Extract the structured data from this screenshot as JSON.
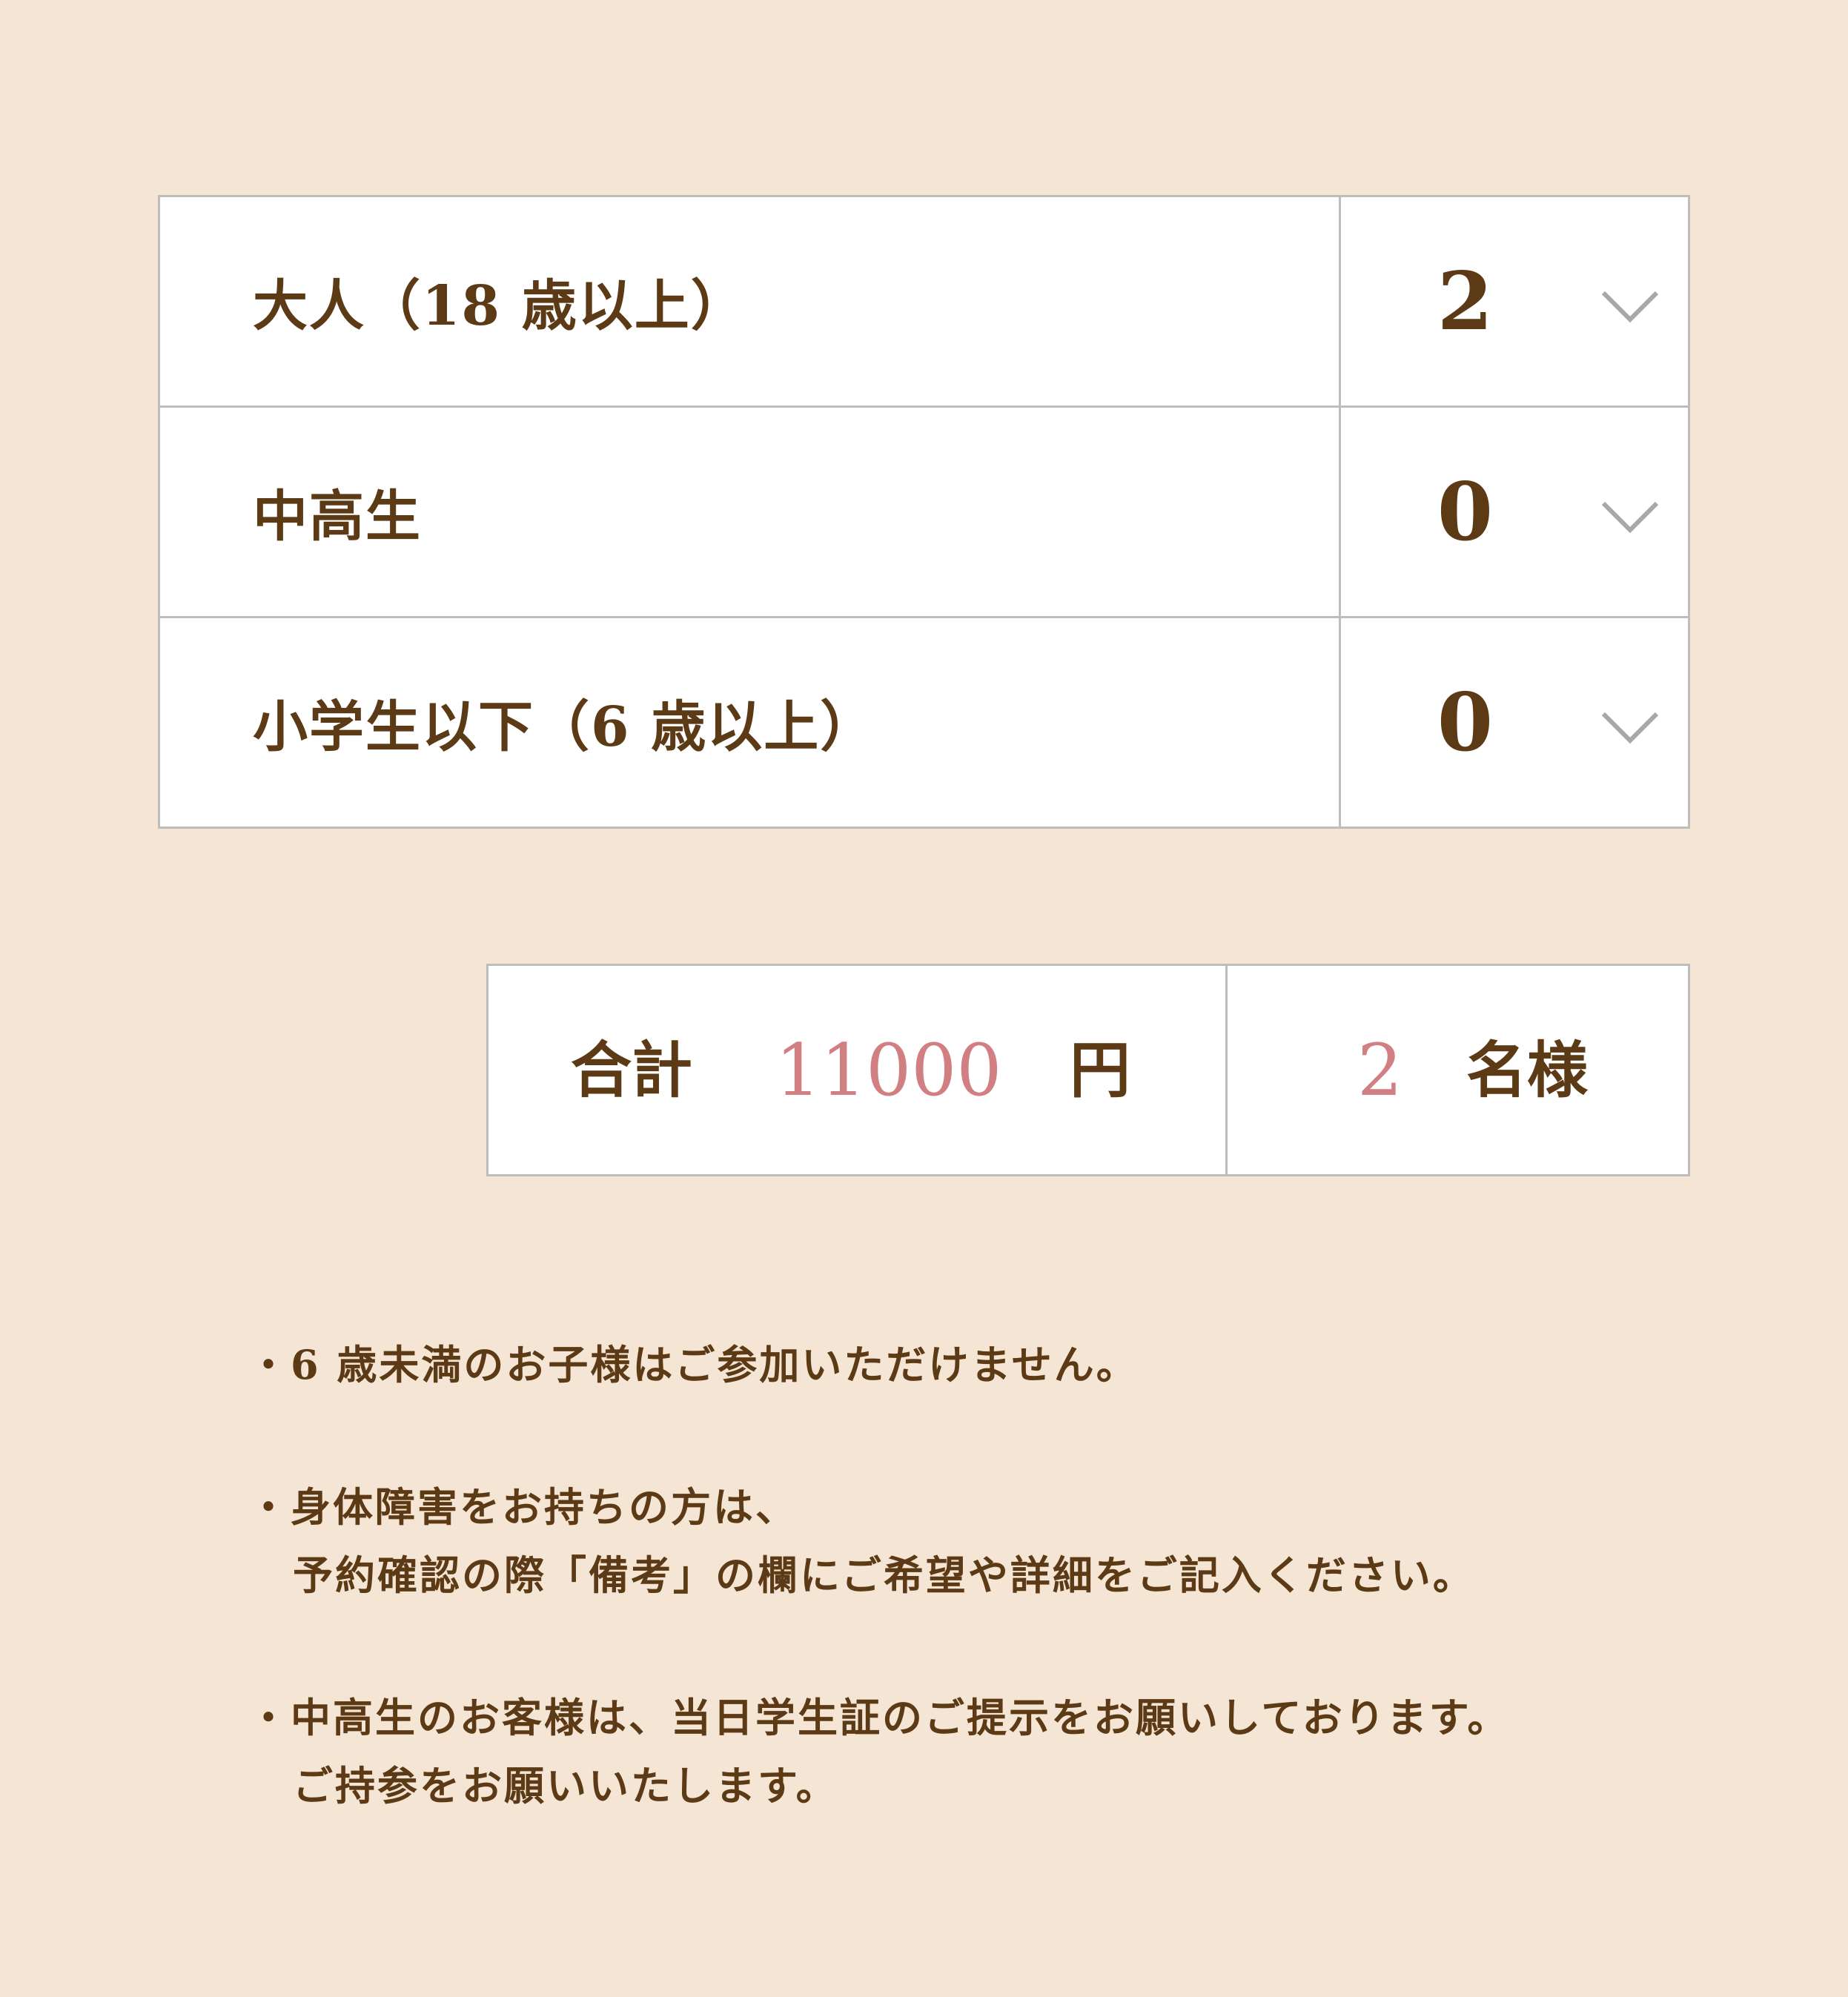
{
  "tickets": [
    {
      "label": "大人（18 歳以上）",
      "count": "2"
    },
    {
      "label": "中高生",
      "count": "0"
    },
    {
      "label": "小学生以下（6 歳以上）",
      "count": "0"
    }
  ],
  "summary": {
    "total_label": "合計",
    "total_amount": "11000",
    "currency": "円",
    "people_count": "2",
    "people_unit": "名様"
  },
  "notes": [
    [
      "・6 歳未満のお子様はご参加いただけません。"
    ],
    [
      "・身体障害をお持ちの方は、",
      "予約確認の際「備考」の欄にご希望や詳細をご記入ください。"
    ],
    [
      "・中高生のお客様は、当日学生証のご提示をお願いしております。",
      "ご持参をお願いいたします。"
    ]
  ],
  "colors": {
    "background": "#f4e5d4",
    "text": "#5c3a16",
    "accent": "#d27f83",
    "border": "#bdbdbd",
    "chevron": "#a8a8a8"
  },
  "icons": {
    "dropdown": "chevron-down-icon"
  }
}
